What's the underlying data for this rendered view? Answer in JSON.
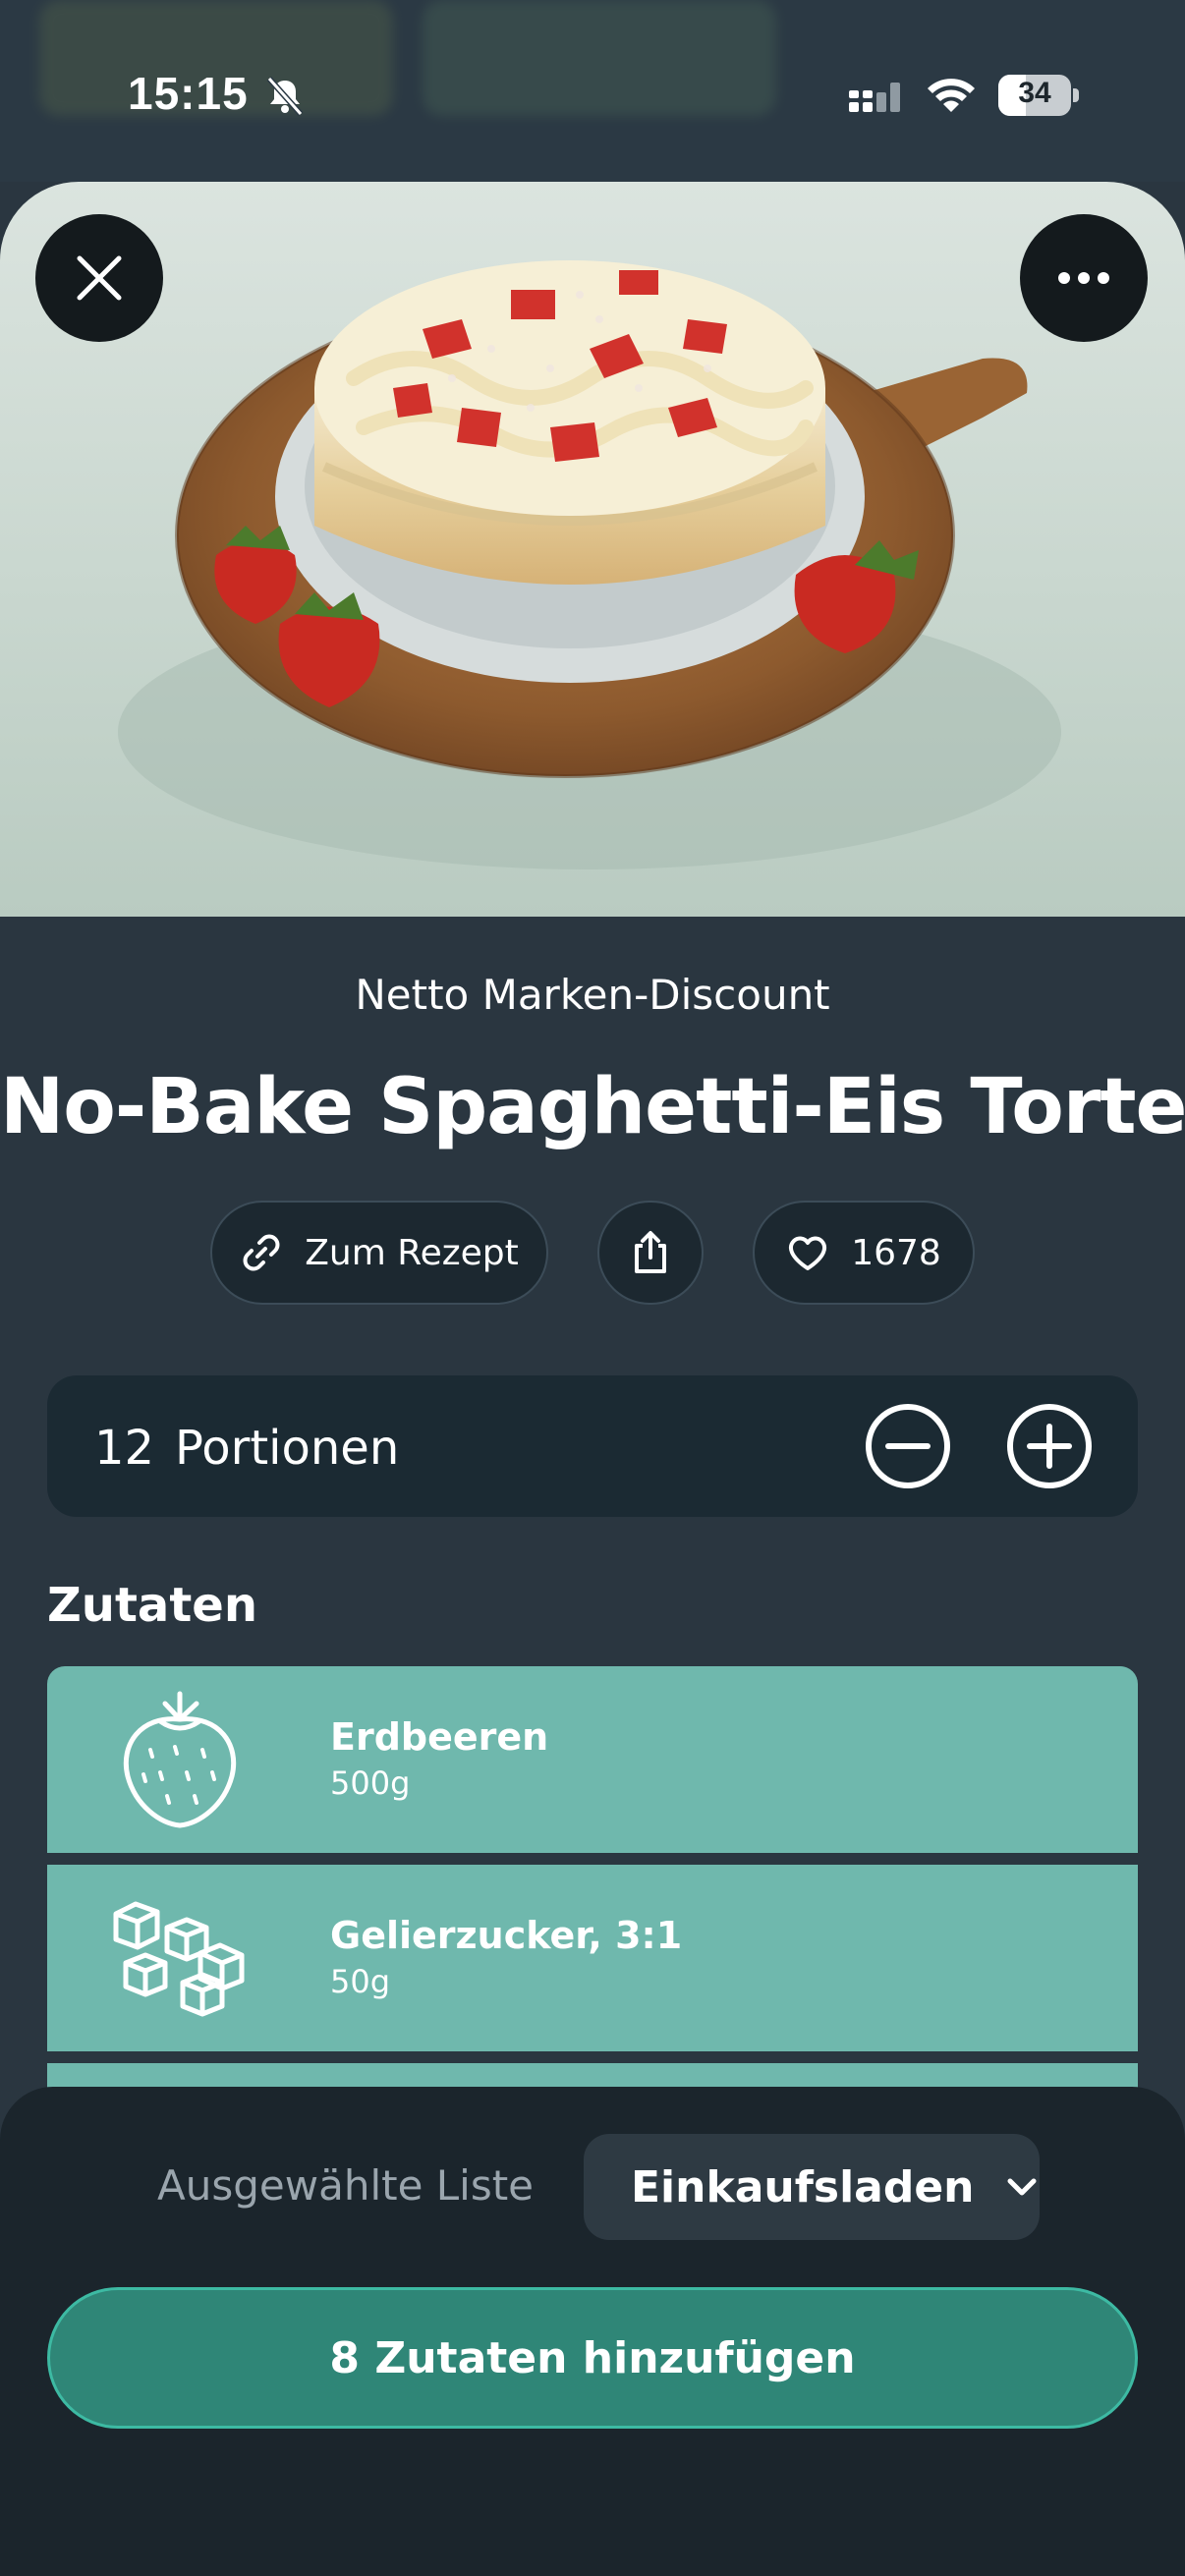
{
  "status_bar": {
    "time": "15:15",
    "battery": "34",
    "icons": [
      "bell-slash-icon",
      "signal-icon",
      "wifi-icon",
      "battery-icon"
    ]
  },
  "hero": {
    "close_icon": "close-icon",
    "more_icon": "more-icon"
  },
  "recipe": {
    "store": "Netto Marken-Discount",
    "title": "No-Bake Spaghetti-Eis Torte",
    "recipe_link_label": "Zum Rezept",
    "likes": "1678"
  },
  "portions": {
    "count": "12",
    "label": "Portionen"
  },
  "ingredients": {
    "heading": "Zutaten",
    "items": [
      {
        "name": "Erdbeeren",
        "amount": "500g",
        "icon": "strawberry-icon"
      },
      {
        "name": "Gelierzucker, 3:1",
        "amount": "50g",
        "icon": "sugar-cubes-icon"
      }
    ]
  },
  "sheet": {
    "selected_list_label": "Ausgewählte Liste",
    "selected_list_value": "Einkaufsladen",
    "add_button": "8 Zutaten hinzufügen"
  },
  "colors": {
    "background": "#2a3640",
    "ingredient_card": "#6fb8ad",
    "primary_button": "#2f8677",
    "primary_border": "#3dbaa3"
  }
}
